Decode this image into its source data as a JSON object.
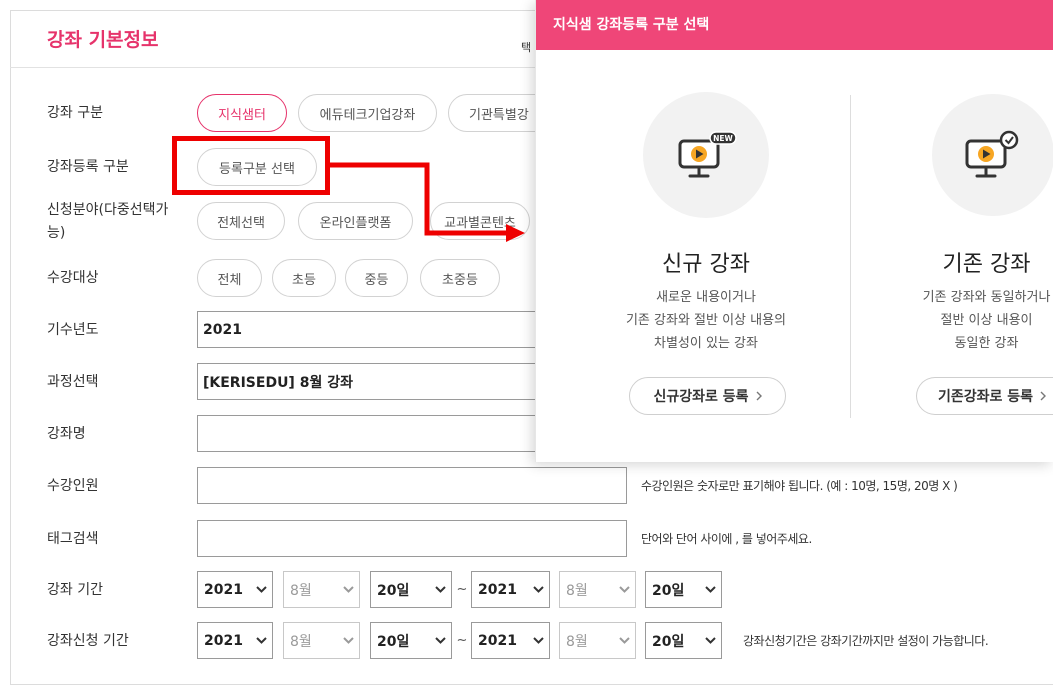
{
  "colors": {
    "accent": "#e6336b",
    "modal_header": "#ef4678",
    "annotation": "#ee0000",
    "icon_circle": "#f2f2f2",
    "play_button": "#f7a623"
  },
  "panel": {
    "title": "강좌 기본정보",
    "header_fragment": "택"
  },
  "form": {
    "course_type": {
      "label": "강좌 구분",
      "options": [
        {
          "label": "지식샘터",
          "selected": true
        },
        {
          "label": "에듀테크기업강좌",
          "selected": false
        },
        {
          "label": "기관특별강",
          "selected": false
        }
      ]
    },
    "registration_type": {
      "label": "강좌등록 구분",
      "button": "등록구분 선택"
    },
    "application_field": {
      "label": "신청분야(다중선택가능)",
      "options": [
        "전체선택",
        "온라인플랫폼",
        "교과별콘텐츠"
      ]
    },
    "target": {
      "label": "수강대상",
      "options": [
        "전체",
        "초등",
        "중등",
        "초중등"
      ]
    },
    "cohort_year": {
      "label": "기수년도",
      "value": "2021"
    },
    "course": {
      "label": "과정선택",
      "value": "[KERISEDU] 8월 강좌"
    },
    "course_name": {
      "label": "강좌명"
    },
    "capacity": {
      "label": "수강인원",
      "help": "수강인원은 숫자로만 표기해야 됩니다. (예 : 10명, 15명, 20명 X )"
    },
    "tags": {
      "label": "태그검색",
      "help": "단어와 단어 사이에 , 를 넣어주세요."
    },
    "period_separator": "~",
    "course_period": {
      "label": "강좌 기간",
      "start": {
        "year": "2021",
        "month": "8월",
        "day": "20일"
      },
      "end": {
        "year": "2021",
        "month": "8월",
        "day": "20일"
      },
      "month_disabled": true
    },
    "application_period": {
      "label": "강좌신청 기간",
      "start": {
        "year": "2021",
        "month": "8월",
        "day": "20일"
      },
      "end": {
        "year": "2021",
        "month": "8월",
        "day": "20일"
      },
      "month_disabled": true,
      "help": "강좌신청기간은 강좌기간까지만 설정이 가능합니다."
    }
  },
  "modal": {
    "title": "지식샘 강좌등록 구분 선택",
    "options": [
      {
        "icon": "monitor-new-icon",
        "badge": "NEW",
        "title": "신규 강좌",
        "description": [
          "새로운 내용이거나",
          "기존 강좌와 절반 이상 내용의",
          "차별성이 있는 강좌"
        ],
        "button": "신규강좌로 등록"
      },
      {
        "icon": "monitor-check-icon",
        "title": "기존 강좌",
        "description": [
          "기존 강좌와 동일하거나",
          "절반 이상 내용이",
          "동일한 강좌"
        ],
        "button": "기존강좌로 등록"
      }
    ]
  }
}
